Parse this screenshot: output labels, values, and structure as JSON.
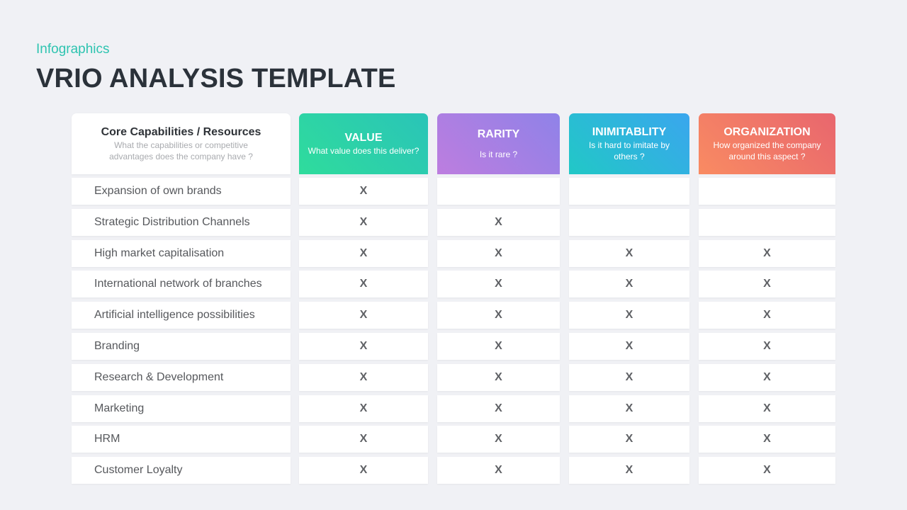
{
  "header": {
    "eyebrow": "Infographics",
    "title": "VRIO ANALYSIS TEMPLATE"
  },
  "columns": [
    {
      "title": "Core Capabilities / Resources",
      "subtitle": "What the capabilities or competitive advantages  does the company have  ?"
    },
    {
      "title": "VALUE",
      "subtitle": "What value  does this deliver?",
      "color_from": "#2fdc9c",
      "color_to": "#2ac4b8"
    },
    {
      "title": "RARITY",
      "subtitle": "Is it rare  ?",
      "color_from": "#bd7ddf",
      "color_to": "#8f82e8"
    },
    {
      "title": "INIMITABLITY",
      "subtitle": "Is it hard to imitate by others ?",
      "color_from": "#21c8c6",
      "color_to": "#3aa6ee"
    },
    {
      "title": "ORGANIZATION",
      "subtitle": "How organized the company around this aspect ?",
      "color_from": "#f98b62",
      "color_to": "#e8666e"
    }
  ],
  "mark_symbol": "X",
  "rows": [
    {
      "label": "Expansion of own brands",
      "marks": [
        true,
        false,
        false,
        false
      ]
    },
    {
      "label": "Strategic Distribution Channels",
      "marks": [
        true,
        true,
        false,
        false
      ]
    },
    {
      "label": "High market capitalisation",
      "marks": [
        true,
        true,
        true,
        true
      ]
    },
    {
      "label": "International  network of branches",
      "marks": [
        true,
        true,
        true,
        true
      ]
    },
    {
      "label": "Artificial intelligence possibilities",
      "marks": [
        true,
        true,
        true,
        true
      ]
    },
    {
      "label": "Branding",
      "marks": [
        true,
        true,
        true,
        true
      ]
    },
    {
      "label": "Research & Development",
      "marks": [
        true,
        true,
        true,
        true
      ]
    },
    {
      "label": "Marketing",
      "marks": [
        true,
        true,
        true,
        true
      ]
    },
    {
      "label": "HRM",
      "marks": [
        true,
        true,
        true,
        true
      ]
    },
    {
      "label": "Customer Loyalty",
      "marks": [
        true,
        true,
        true,
        true
      ]
    }
  ]
}
